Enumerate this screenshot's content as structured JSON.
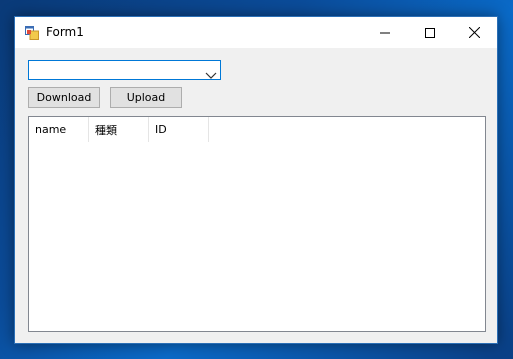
{
  "window": {
    "title": "Form1",
    "icon": "winforms-app-icon",
    "controls": {
      "minimize_icon": "minimize-icon",
      "maximize_icon": "maximize-icon",
      "close_icon": "close-icon"
    }
  },
  "combo": {
    "value": "",
    "arrow_icon": "chevron-down-icon",
    "border_color": "#0078d7"
  },
  "buttons": {
    "download_label": "Download",
    "upload_label": "Upload"
  },
  "listview": {
    "columns": [
      "name",
      "種類",
      "ID"
    ],
    "rows": []
  },
  "colors": {
    "window_bg": "#f0f0f0",
    "titlebar_bg": "#ffffff",
    "accent": "#0078d7"
  }
}
